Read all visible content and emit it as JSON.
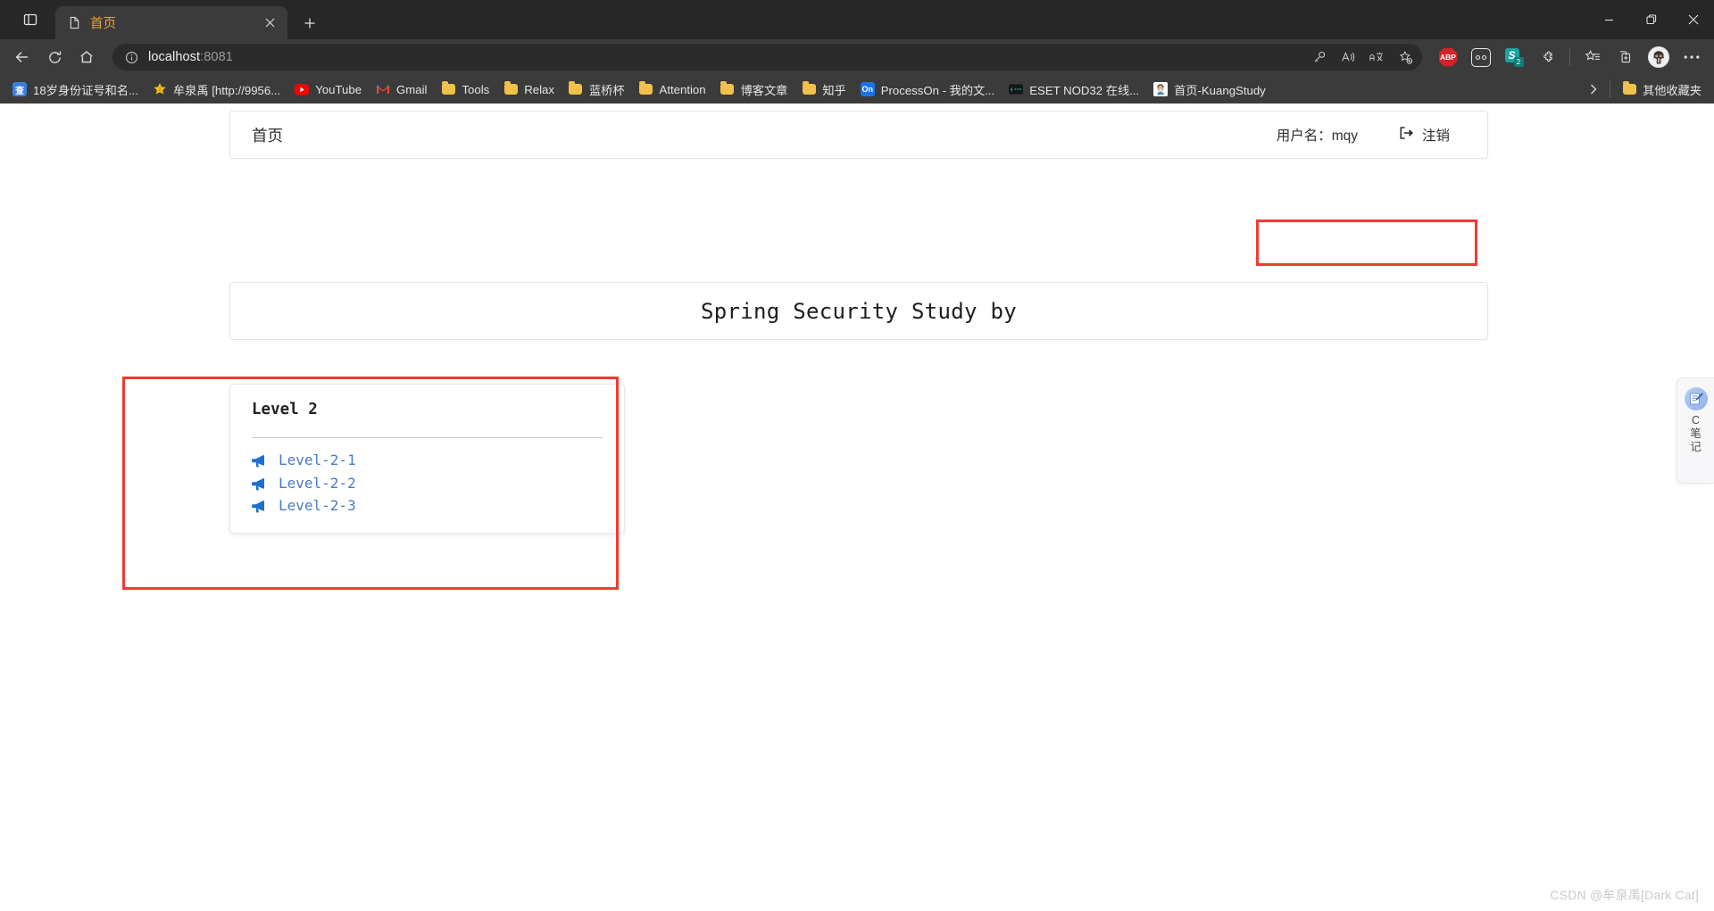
{
  "browser": {
    "tab": {
      "title": "首页",
      "favicon": "page-icon",
      "close": "×"
    },
    "tab_search_tooltip": "Tab actions",
    "new_tab": "+",
    "window_controls": {
      "minimize": "—",
      "maximize": "❐",
      "close": "✕"
    },
    "nav": {
      "back": "←",
      "refresh": "⟳",
      "home": "⌂",
      "url_full": "localhost:8081",
      "url_host": "localhost",
      "url_rest": ":8081",
      "info_icon": "ⓘ"
    },
    "omni_actions": [
      "key-icon",
      "read-aloud-icon",
      "translate-icon",
      "add-favorite-icon"
    ],
    "extensions": [
      {
        "name": "adblock-plus",
        "label": "ABP"
      },
      {
        "name": "privacy-badger",
        "label": "oo"
      },
      {
        "name": "s-note",
        "label": "S",
        "badge": "2"
      },
      {
        "name": "extensions-puzzle",
        "label": ""
      }
    ],
    "toolbar_right": [
      "favorites-icon",
      "collections-icon",
      "profile-avatar",
      "settings-more-icon"
    ],
    "bookmarks": [
      {
        "label": "18岁身份证号和名...",
        "icon": "query-badge",
        "icon_text": "查",
        "icon_color": "#3b7ddd"
      },
      {
        "label": "牟泉禹 [http://9956...",
        "icon": "star-icon",
        "icon_color": "#f5c518"
      },
      {
        "label": "YouTube",
        "icon": "youtube-icon",
        "icon_color": "#ff0000"
      },
      {
        "label": "Gmail",
        "icon": "gmail-icon",
        "icon_color": "#ea4335"
      },
      {
        "label": "Tools",
        "icon": "folder-icon",
        "icon_color": "#f2c14b"
      },
      {
        "label": "Relax",
        "icon": "folder-icon",
        "icon_color": "#f2c14b"
      },
      {
        "label": "蓝桥杯",
        "icon": "folder-icon",
        "icon_color": "#f2c14b"
      },
      {
        "label": "Attention",
        "icon": "folder-icon",
        "icon_color": "#f2c14b"
      },
      {
        "label": "博客文章",
        "icon": "folder-icon",
        "icon_color": "#f2c14b"
      },
      {
        "label": "知乎",
        "icon": "folder-icon",
        "icon_color": "#f2c14b"
      },
      {
        "label": "ProcessOn - 我的文...",
        "icon": "processon-icon",
        "icon_text": "On",
        "icon_color": "#1a73e8"
      },
      {
        "label": "ESET NOD32 在线...",
        "icon": "eset-icon",
        "icon_color": "#0fa36b"
      },
      {
        "label": "首页-KuangStudy",
        "icon": "kuangstudy-avatar",
        "icon_color": "#7b5a3a"
      }
    ],
    "bookmarks_overflow": "›",
    "other_bookmarks": {
      "label": "其他收藏夹",
      "icon": "folder-icon"
    }
  },
  "page": {
    "navbar": {
      "brand": "首页",
      "username_label": "用户名：mqy",
      "logout_label": "注销",
      "logout_icon": "sign-out-icon"
    },
    "jumbotron": {
      "title": "Spring Security Study by"
    },
    "card": {
      "title": "Level 2",
      "links": [
        {
          "label": "Level-2-1",
          "icon": "bullhorn-icon"
        },
        {
          "label": "Level-2-2",
          "icon": "bullhorn-icon"
        },
        {
          "label": "Level-2-3",
          "icon": "bullhorn-icon"
        }
      ]
    },
    "annotations": [
      {
        "name": "user-area-highlight",
        "color": "#f23b33"
      },
      {
        "name": "level2-card-highlight",
        "color": "#f23b33"
      }
    ],
    "float_widget": {
      "icon": "notebook-pen-icon",
      "lines": [
        "C",
        "笔",
        "记"
      ]
    },
    "watermark": "CSDN @牟泉禹[Dark Cat]"
  },
  "colors": {
    "chrome_bg": "#272727",
    "toolbar_bg": "#3b3b3b",
    "omnibox_bg": "#2b2b2b",
    "tab_active": "#3b3b3b",
    "tab_title": "#e8a33d",
    "link_blue": "#4a79c7",
    "annotation_red": "#f23b33",
    "page_bg": "#ffffff"
  }
}
